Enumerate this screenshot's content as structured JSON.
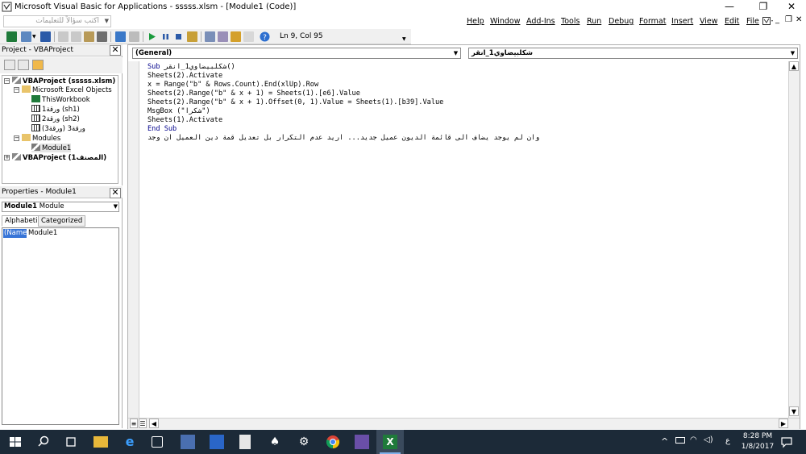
{
  "window": {
    "title": "Microsoft Visual Basic for Applications - sssss.xlsm - [Module1 (Code)]",
    "controls": {
      "minimize": "—",
      "restore": "❐",
      "close": "✕"
    }
  },
  "menubar": {
    "ask_placeholder": "اكتب سؤالاً للتعليمات",
    "items": [
      "Help",
      "Window",
      "Add-Ins",
      "Tools",
      "Run",
      "Debug",
      "Format",
      "Insert",
      "View",
      "Edit",
      "File"
    ],
    "mdi_controls": {
      "minimize": "_",
      "restore": "❐",
      "close": "✕"
    }
  },
  "toolbar": {
    "position": "Ln 9, Col 95"
  },
  "project_pane": {
    "title": "Project - VBAProject",
    "close": "✕",
    "tree": [
      {
        "label": "VBAProject (sssss.xlsm)",
        "level": 0,
        "bold": true
      },
      {
        "label": "Microsoft Excel Objects",
        "level": 1,
        "bold": false
      },
      {
        "label": "ThisWorkbook",
        "level": 2,
        "bold": false
      },
      {
        "label": "ورقة1 (sh1)",
        "level": 2,
        "bold": false
      },
      {
        "label": "ورقة2 (sh2)",
        "level": 2,
        "bold": false
      },
      {
        "label": "ورقة3 (ورقة3)",
        "level": 2,
        "bold": false
      },
      {
        "label": "Modules",
        "level": 1,
        "bold": false
      },
      {
        "label": "Module1",
        "level": 2,
        "bold": false
      },
      {
        "label": "VBAProject (المصنف1)",
        "level": 0,
        "bold": true
      }
    ]
  },
  "properties_pane": {
    "title": "Properties - Module1",
    "close": "✕",
    "object_name": "Module1",
    "object_type": "Module",
    "tabs": [
      "Alphabetic",
      "Categorized"
    ],
    "rows": [
      {
        "name": "(Name)",
        "value": "Module1"
      }
    ]
  },
  "code_window": {
    "object_combo": "(General)",
    "procedure_combo": "شكلبيضاوي1_انقر",
    "lines": [
      "Sub شكلبيضاوي1_انقر()",
      "Sheets(2).Activate",
      "x = Range(\"b\" & Rows.Count).End(xlUp).Row",
      "Sheets(2).Range(\"b\" & x + 1) = Sheets(1).[e6].Value",
      "Sheets(2).Range(\"b\" & x + 1).Offset(0, 1).Value = Sheets(1).[b39].Value",
      "MsgBox (\"شكرا\")",
      "Sheets(1).Activate",
      "End Sub",
      "وان لم يوجد يضاف الى قائمة الديون عميل جديد... اريد عدم التكرار بل تعديل قمة دين العميل ان وجد"
    ]
  },
  "taskbar": {
    "time": "8:28 PM",
    "date": "1/8/2017",
    "ime": "ع"
  }
}
